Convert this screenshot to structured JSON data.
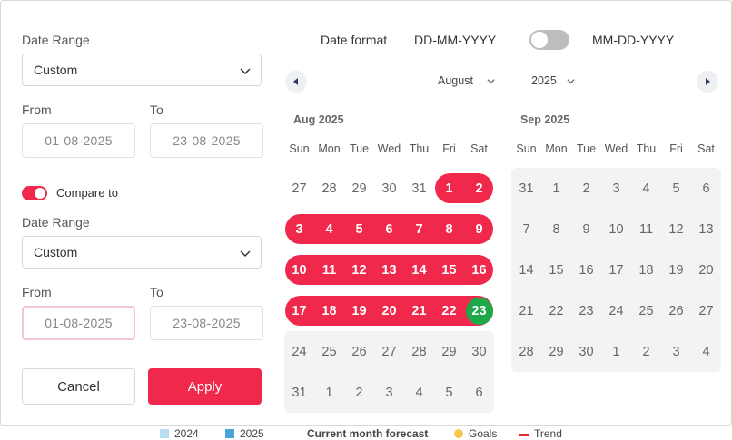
{
  "left": {
    "date_range_label": "Date Range",
    "date_range_value": "Custom",
    "from_label": "From",
    "to_label": "To",
    "from_value": "01-08-2025",
    "to_value": "23-08-2025",
    "compare_label": "Compare to",
    "compare_enabled": true,
    "compare_range_label": "Date Range",
    "compare_range_value": "Custom",
    "compare_from_label": "From",
    "compare_to_label": "To",
    "compare_from_value": "01-08-2025",
    "compare_to_value": "23-08-2025",
    "cancel_label": "Cancel",
    "apply_label": "Apply"
  },
  "format": {
    "label": "Date format",
    "option_a": "DD-MM-YYYY",
    "option_b": "MM-DD-YYYY",
    "toggle_on": false
  },
  "nav": {
    "month": "August",
    "year": "2025"
  },
  "weekdays": [
    "Sun",
    "Mon",
    "Tue",
    "Wed",
    "Thu",
    "Fri",
    "Sat"
  ],
  "calendars": [
    {
      "title": "Aug 2025",
      "weeks": [
        [
          "27",
          "28",
          "29",
          "30",
          "31",
          "1",
          "2"
        ],
        [
          "3",
          "4",
          "5",
          "6",
          "7",
          "8",
          "9"
        ],
        [
          "10",
          "11",
          "12",
          "13",
          "14",
          "15",
          "16"
        ],
        [
          "17",
          "18",
          "19",
          "20",
          "21",
          "22",
          "23"
        ],
        [
          "24",
          "25",
          "26",
          "27",
          "28",
          "29",
          "30"
        ],
        [
          "31",
          "1",
          "2",
          "3",
          "4",
          "5",
          "6"
        ]
      ]
    },
    {
      "title": "Sep 2025",
      "weeks": [
        [
          "31",
          "1",
          "2",
          "3",
          "4",
          "5",
          "6"
        ],
        [
          "7",
          "8",
          "9",
          "10",
          "11",
          "12",
          "13"
        ],
        [
          "14",
          "15",
          "16",
          "17",
          "18",
          "19",
          "20"
        ],
        [
          "21",
          "22",
          "23",
          "24",
          "25",
          "26",
          "27"
        ],
        [
          "28",
          "29",
          "30",
          "1",
          "2",
          "3",
          "4"
        ]
      ]
    }
  ],
  "selection": {
    "start": "1",
    "end": "23",
    "month": "Aug 2025"
  },
  "legend": [
    "2024",
    "2025",
    "Current month forecast",
    "Goals",
    "Trend"
  ],
  "colors": {
    "accent": "#f0284b",
    "end_marker": "#1ea84a"
  }
}
